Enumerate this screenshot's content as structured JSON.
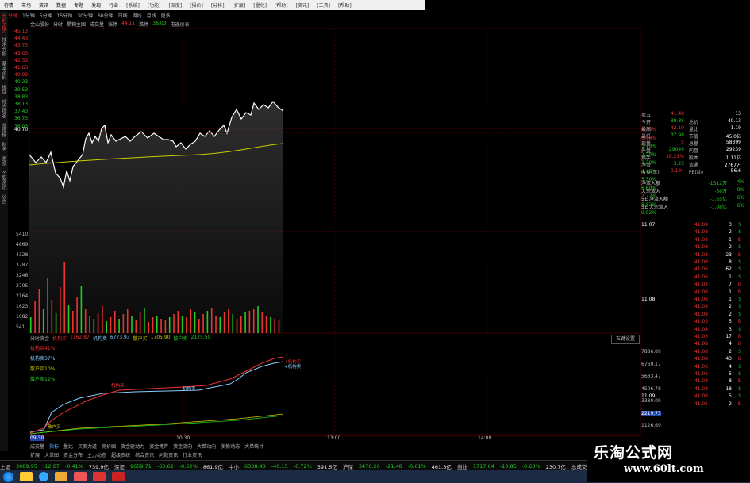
{
  "menu": [
    "行情",
    "市场",
    "资讯",
    "数据",
    "专题",
    "发现",
    "行业",
    "[系统]",
    "[功能]",
    "[深度]",
    "[报价]",
    "[分析]",
    "[扩展]",
    "[量化]",
    "[帮助]",
    "[资讯]",
    "[工具]",
    "[帮助]"
  ],
  "periods": [
    "分时",
    "1分钟",
    "5分钟",
    "15分钟",
    "30分钟",
    "60分钟",
    "日线",
    "周线",
    "月线",
    "更多"
  ],
  "left_tabs": [
    "分时走势",
    "技术分析",
    "基本资料",
    "板块",
    "综合排名",
    "龙虎榜",
    "财务",
    "更多",
    "个股资讯",
    "公告"
  ],
  "stock_header": {
    "name": "金山股份",
    "tag": "分时",
    "type": "累积主图",
    "vol_label": "成交量",
    "up_label": "涨停",
    "up_val": "44.11",
    "down_label": "跌停",
    "down_val": "36.03",
    "extra": "电遥仪表"
  },
  "price_axis": [
    "45.13",
    "44.43",
    "43.73",
    "43.03",
    "42.33",
    "41.63",
    "40.93",
    "40.23",
    "39.53",
    "38.83",
    "38.13",
    "37.43",
    "36.73",
    "36.03"
  ],
  "price_axis_mid": "40.70",
  "vol_axis": [
    "5410",
    "4869",
    "4328",
    "3787",
    "3246",
    "2705",
    "2164",
    "1623",
    "1082",
    "541"
  ],
  "lower_header": {
    "tab": "分时资金",
    "a": "机构买",
    "a_val": "1162.87",
    "b": "机构卖",
    "b_val": "6773.93",
    "c": "散户买",
    "c_val": "1705.90",
    "d": "散户卖",
    "d_val": "2125.59"
  },
  "legend": [
    {
      "label": "机构买41%",
      "color": "#e33"
    },
    {
      "label": "机构卖37%",
      "color": "#8cf"
    },
    {
      "label": "散户买10%",
      "color": "#cc0"
    },
    {
      "label": "散户卖12%",
      "color": "#2c2"
    }
  ],
  "annotations": [
    "+机构买",
    "+机构卖",
    "机构卖",
    "机构买",
    "散户买"
  ],
  "time_axis": [
    "09:30",
    "10:30",
    "13:00",
    "14:00"
  ],
  "bottom_tabs": [
    "成交量",
    "指标",
    "量比",
    "买卖力道",
    "竞价图",
    "资金驱动力",
    "资金博弈",
    "资金流向",
    "大单动向",
    "多换动态",
    "大单统计"
  ],
  "bottom_tabs2": [
    "扩展",
    "大单图",
    "资金分布",
    "主力动态",
    "超级资统",
    "综合资讯",
    "问题资讯",
    "行业资讯"
  ],
  "setting_btn": "右键设置",
  "quote_rows": [
    {
      "l": "卖五",
      "v": "41.48",
      "r": "",
      "rv": "13"
    },
    {
      "l": "今开",
      "v": "39.35",
      "r": "总价",
      "rv": "40.13"
    },
    {
      "l": "最高",
      "v": "42.10",
      "r": "量比",
      "rv": "1.19"
    },
    {
      "l": "最低",
      "v": "37.98",
      "r": "市值",
      "rv": "45.0亿"
    },
    {
      "l": "现量",
      "v": "5",
      "r": "总量",
      "rv": "58399"
    },
    {
      "l": "外盘",
      "v": "29049",
      "r": "内盘",
      "rv": "29239"
    },
    {
      "l": "换手",
      "v": "18.21%",
      "r": "股本",
      "rv": "1.11亿"
    },
    {
      "l": "净资",
      "v": "3.23",
      "r": "流通",
      "rv": "2767万"
    },
    {
      "l": "收益(三)",
      "v": "0.184",
      "r": "PE(动)",
      "rv": "56.6"
    }
  ],
  "flow_rows": [
    {
      "l": "净流入额",
      "v": "-1312万",
      "p": "4%"
    },
    {
      "l": "大宗流入",
      "v": "-56万",
      "p": "0%"
    },
    {
      "l": "5日净流入额",
      "v": "-1.65亿",
      "p": "6%"
    },
    {
      "l": "5日大宗流入",
      "v": "-1.08亿",
      "p": "6%"
    }
  ],
  "pct_axis": [
    "1.10%",
    "0.00%",
    "1.10%",
    "2.20%",
    "3.30%",
    "4.40%",
    "5.50%",
    "6.60%",
    "7.72%",
    "8.82%",
    "9.92%"
  ],
  "trades": [
    {
      "t": "11:07",
      "p": "41.08",
      "v": "3",
      "s": "S"
    },
    {
      "t": "",
      "p": "41.08",
      "v": "2",
      "s": "S"
    },
    {
      "t": "",
      "p": "41.08",
      "v": "1",
      "s": "B"
    },
    {
      "t": "",
      "p": "41.08",
      "v": "2",
      "s": "S"
    },
    {
      "t": "",
      "p": "41.08",
      "v": "23",
      "s": "B"
    },
    {
      "t": "",
      "p": "41.08",
      "v": "8",
      "s": "S"
    },
    {
      "t": "",
      "p": "41.06",
      "v": "62",
      "s": "S"
    },
    {
      "t": "",
      "p": "41.06",
      "v": "1",
      "s": "S"
    },
    {
      "t": "",
      "p": "41.03",
      "v": "7",
      "s": "B"
    },
    {
      "t": "",
      "p": "41.08",
      "v": "1",
      "s": "B"
    },
    {
      "t": "11:08",
      "p": "41.08",
      "v": "1",
      "s": "S"
    },
    {
      "t": "",
      "p": "41.08",
      "v": "2",
      "s": "S"
    },
    {
      "t": "",
      "p": "41.08",
      "v": "2",
      "s": "S"
    },
    {
      "t": "",
      "p": "41.03",
      "v": "5",
      "s": "B"
    },
    {
      "t": "",
      "p": "41.08",
      "v": "3",
      "s": "S"
    },
    {
      "t": "",
      "p": "41.03",
      "v": "17",
      "s": "B"
    },
    {
      "t": "",
      "p": "41.08",
      "v": "4",
      "s": "B"
    },
    {
      "t": "",
      "p": "41.08",
      "v": "2",
      "s": "S"
    },
    {
      "t": "",
      "p": "41.08",
      "v": "43",
      "s": "B"
    },
    {
      "t": "",
      "p": "41.06",
      "v": "4",
      "s": "S"
    },
    {
      "t": "",
      "p": "41.06",
      "v": "5",
      "s": "S"
    },
    {
      "t": "",
      "p": "41.08",
      "v": "8",
      "s": "B"
    },
    {
      "t": "",
      "p": "41.08",
      "v": "18",
      "s": "S"
    },
    {
      "t": "11:09",
      "p": "41.08",
      "v": "5",
      "s": "S"
    },
    {
      "t": "",
      "p": "41.05",
      "v": "2",
      "s": "B"
    }
  ],
  "side_axis": [
    "7886.89",
    "6760.17",
    "5633.47",
    "4506.78",
    "3380.09",
    "2219.73",
    "1126.69"
  ],
  "ticker": [
    {
      "lab": "上证",
      "v": "3089.95",
      "c": "-12.67",
      "p": "-0.41%",
      "a": "739.9亿"
    },
    {
      "lab": "深证",
      "v": "9659.71",
      "c": "-60.62",
      "p": "-0.62%",
      "a": "861.9亿"
    },
    {
      "lab": "中小",
      "v": "6338.48",
      "c": "-46.15",
      "p": "-0.72%",
      "a": "391.5亿"
    },
    {
      "lab": "沪深",
      "v": "3476.26",
      "c": "-21.48",
      "p": "-0.61%",
      "a": "461.3亿"
    },
    {
      "lab": "创业",
      "v": "1717.64",
      "c": "-10.85",
      "p": "-0.63%",
      "a": "230.7亿"
    }
  ],
  "ticker_tail": "总成交 1602亿 杭州解",
  "watermark": {
    "title": "乐淘公式网",
    "url": "www.60lt.com"
  }
}
